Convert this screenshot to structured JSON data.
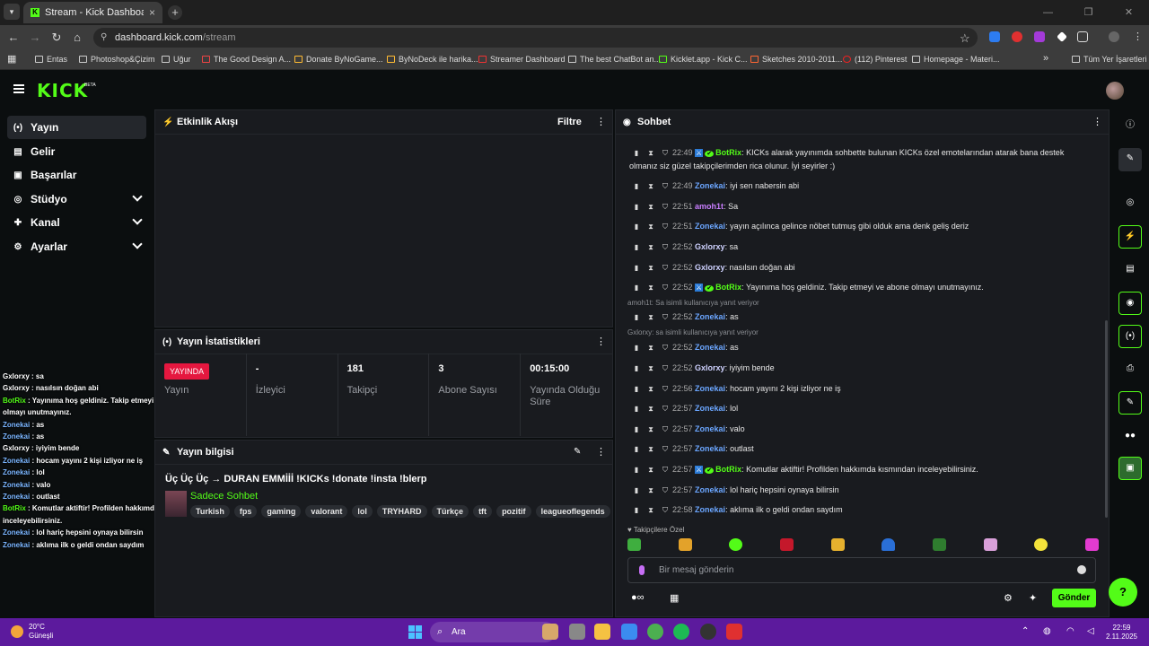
{
  "browser": {
    "tab_title": "Stream - Kick Dashboard",
    "url_host": "dashboard.kick.com",
    "url_path": "/stream",
    "bookmarks": [
      "Entas",
      "Photoshop&Çizim",
      "Uğur",
      "The Good Design A...",
      "Donate ByNoGame...",
      "ByNoDeck ile harika...",
      "Streamer Dashboard",
      "The best ChatBot an...",
      "Kicklet.app - Kick C...",
      "Sketches 2010-2011...",
      "(112) Pinterest",
      "Homepage - Materi..."
    ],
    "all_bookmarks": "Tüm Yer İşaretleri"
  },
  "kick": {
    "logo": "KICK",
    "beta": "BETA"
  },
  "nav": [
    {
      "label": "Yayın",
      "icon": "broadcast-icon",
      "active": true
    },
    {
      "label": "Gelir",
      "icon": "revenue-icon"
    },
    {
      "label": "Başarılar",
      "icon": "trophy-icon"
    },
    {
      "label": "Stüdyo",
      "icon": "studio-icon",
      "expandable": true
    },
    {
      "label": "Kanal",
      "icon": "channel-icon",
      "expandable": true
    },
    {
      "label": "Ayarlar",
      "icon": "gear-icon",
      "expandable": true
    }
  ],
  "overlay_chat": [
    {
      "user": "Gxlorxy",
      "text": " : sa"
    },
    {
      "user": "Gxlorxy",
      "text": " : nasılsın doğan abi"
    },
    {
      "user": "BotRix",
      "text": " : Yayınıma hoş geldiniz. Takip etmeyi ve abone olmayı unutmayınız."
    },
    {
      "user": "Zonekai",
      "text": " : as"
    },
    {
      "user": "Zonekai",
      "text": " : as"
    },
    {
      "user": "Gxlorxy",
      "text": " : iyiyim bende"
    },
    {
      "user": "Zonekai",
      "text": " : hocam yayını 2 kişi izliyor ne iş"
    },
    {
      "user": "Zonekai",
      "text": " : lol"
    },
    {
      "user": "Zonekai",
      "text": " : valo"
    },
    {
      "user": "Zonekai",
      "text": " : outlast"
    },
    {
      "user": "BotRix",
      "text": " : Komutlar aktiftir! Profilden hakkımda kısmından inceleyebilirsiniz."
    },
    {
      "user": "Zonekai",
      "text": " : lol hariç hepsini oynaya bilirsin"
    },
    {
      "user": "Zonekai",
      "text": " : aklıma ilk o geldi ondan saydım"
    }
  ],
  "activity": {
    "title": "Etkinlik Akışı",
    "filter": "Filtre"
  },
  "stats": {
    "title": "Yayın İstatistikleri",
    "live_badge": "YAYINDA",
    "items": [
      {
        "value": "",
        "label": "Yayın"
      },
      {
        "value": "-",
        "label": "İzleyici"
      },
      {
        "value": "181",
        "label": "Takipçi"
      },
      {
        "value": "3",
        "label": "Abone Sayısı"
      },
      {
        "value": "00:15:00",
        "label": "Yayında Olduğu Süre"
      }
    ]
  },
  "stream_info": {
    "title": "Yayın bilgisi",
    "stream_title": "Üç Üç Üç → DURAN EMMİİİ !KICKs !donate !insta !blerp",
    "category": "Sadece Sohbet",
    "tags": [
      "Turkish",
      "fps",
      "gaming",
      "valorant",
      "lol",
      "TRYHARD",
      "Türkçe",
      "tft",
      "pozitif",
      "leagueoflegends"
    ]
  },
  "chat": {
    "title": "Sohbet",
    "messages": [
      {
        "time": "22:49",
        "user": "BotRix",
        "cls": "u-bot",
        "text": "KICKs alarak yayınımda sohbette bulunan KICKs özel emotelarından atarak bana destek olmanız siz güzel takipçilerimden rica olunur. İyi seyirler :)"
      },
      {
        "time": "22:49",
        "user": "Zonekai",
        "cls": "u-zon",
        "text": "iyi sen nabersin abi"
      },
      {
        "time": "22:51",
        "user": "amoh1t",
        "cls": "u-amo",
        "text": "Sa"
      },
      {
        "time": "22:51",
        "user": "Zonekai",
        "cls": "u-zon",
        "text": "yayın açılınca gelince nöbet tutmuş gibi olduk ama denk geliş deriz"
      },
      {
        "time": "22:52",
        "user": "Gxlorxy",
        "cls": "u-gx",
        "text": "sa"
      },
      {
        "time": "22:52",
        "user": "Gxlorxy",
        "cls": "u-gx",
        "text": "nasılsın doğan abi"
      },
      {
        "time": "22:52",
        "user": "BotRix",
        "cls": "u-bot",
        "text": "Yayınıma hoş geldiniz. Takip etmeyi ve abone olmayı unutmayınız."
      },
      {
        "time": "22:52",
        "user": "Zonekai",
        "cls": "u-zon",
        "text": "as"
      },
      {
        "time": "22:52",
        "user": "Zonekai",
        "cls": "u-zon",
        "text": "as"
      },
      {
        "time": "22:52",
        "user": "Gxlorxy",
        "cls": "u-gx",
        "text": "iyiyim bende"
      },
      {
        "time": "22:56",
        "user": "Zonekai",
        "cls": "u-zon",
        "text": "hocam yayını 2 kişi izliyor ne iş"
      },
      {
        "time": "22:57",
        "user": "Zonekai",
        "cls": "u-zon",
        "text": "lol"
      },
      {
        "time": "22:57",
        "user": "Zonekai",
        "cls": "u-zon",
        "text": "valo"
      },
      {
        "time": "22:57",
        "user": "Zonekai",
        "cls": "u-zon",
        "text": "outlast"
      },
      {
        "time": "22:57",
        "user": "BotRix",
        "cls": "u-bot",
        "text": "Komutlar aktiftir! Profilden hakkımda kısmından inceleyebilirsiniz."
      },
      {
        "time": "22:57",
        "user": "Zonekai",
        "cls": "u-zon",
        "text": "lol hariç hepsini oynaya bilirsin"
      },
      {
        "time": "22:58",
        "user": "Zonekai",
        "cls": "u-zon",
        "text": "aklıma ilk o geldi ondan saydım"
      }
    ],
    "replies": [
      "amoh1t: Sa isimli kullanıcıya yanıt veriyor",
      "Gxlorxy: sa isimli kullanıcıya yanıt veriyor"
    ],
    "subscriber_emotes_label": "Takipçilere Özel",
    "input_placeholder": "Bir mesaj gönderin",
    "send_label": "Gönder"
  },
  "taskbar": {
    "temp": "20°C",
    "weather": "Güneşli",
    "search": "Ara",
    "time": "22:59",
    "date": "2.11.2025"
  },
  "colors": {
    "accent": "#53fc18",
    "live": "#e5173f",
    "taskbar": "#5c1a9d"
  }
}
